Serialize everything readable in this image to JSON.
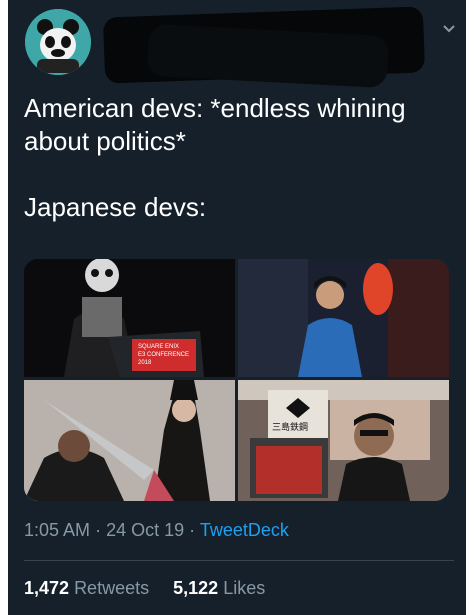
{
  "tweet": {
    "text": "American devs: *endless whining\nabout politics*\n\nJapanese devs:",
    "media_caption_1": "SQUARE ENIX",
    "media_caption_2": "E3 CONFERENCE",
    "media_caption_3": "2018",
    "poster_text": "三島鉄鋼",
    "time": "1:05 AM",
    "date": "24 Oct 19",
    "sep": "·",
    "client": "TweetDeck",
    "retweets_count": "1,472",
    "retweets_label": "Retweets",
    "likes_count": "5,122",
    "likes_label": "Likes"
  },
  "icons": {
    "menu": "chevron-down-icon",
    "avatar": "panda-avatar"
  },
  "colors": {
    "background": "#15202b",
    "link": "#1da1f2",
    "muted": "#8899a6"
  }
}
